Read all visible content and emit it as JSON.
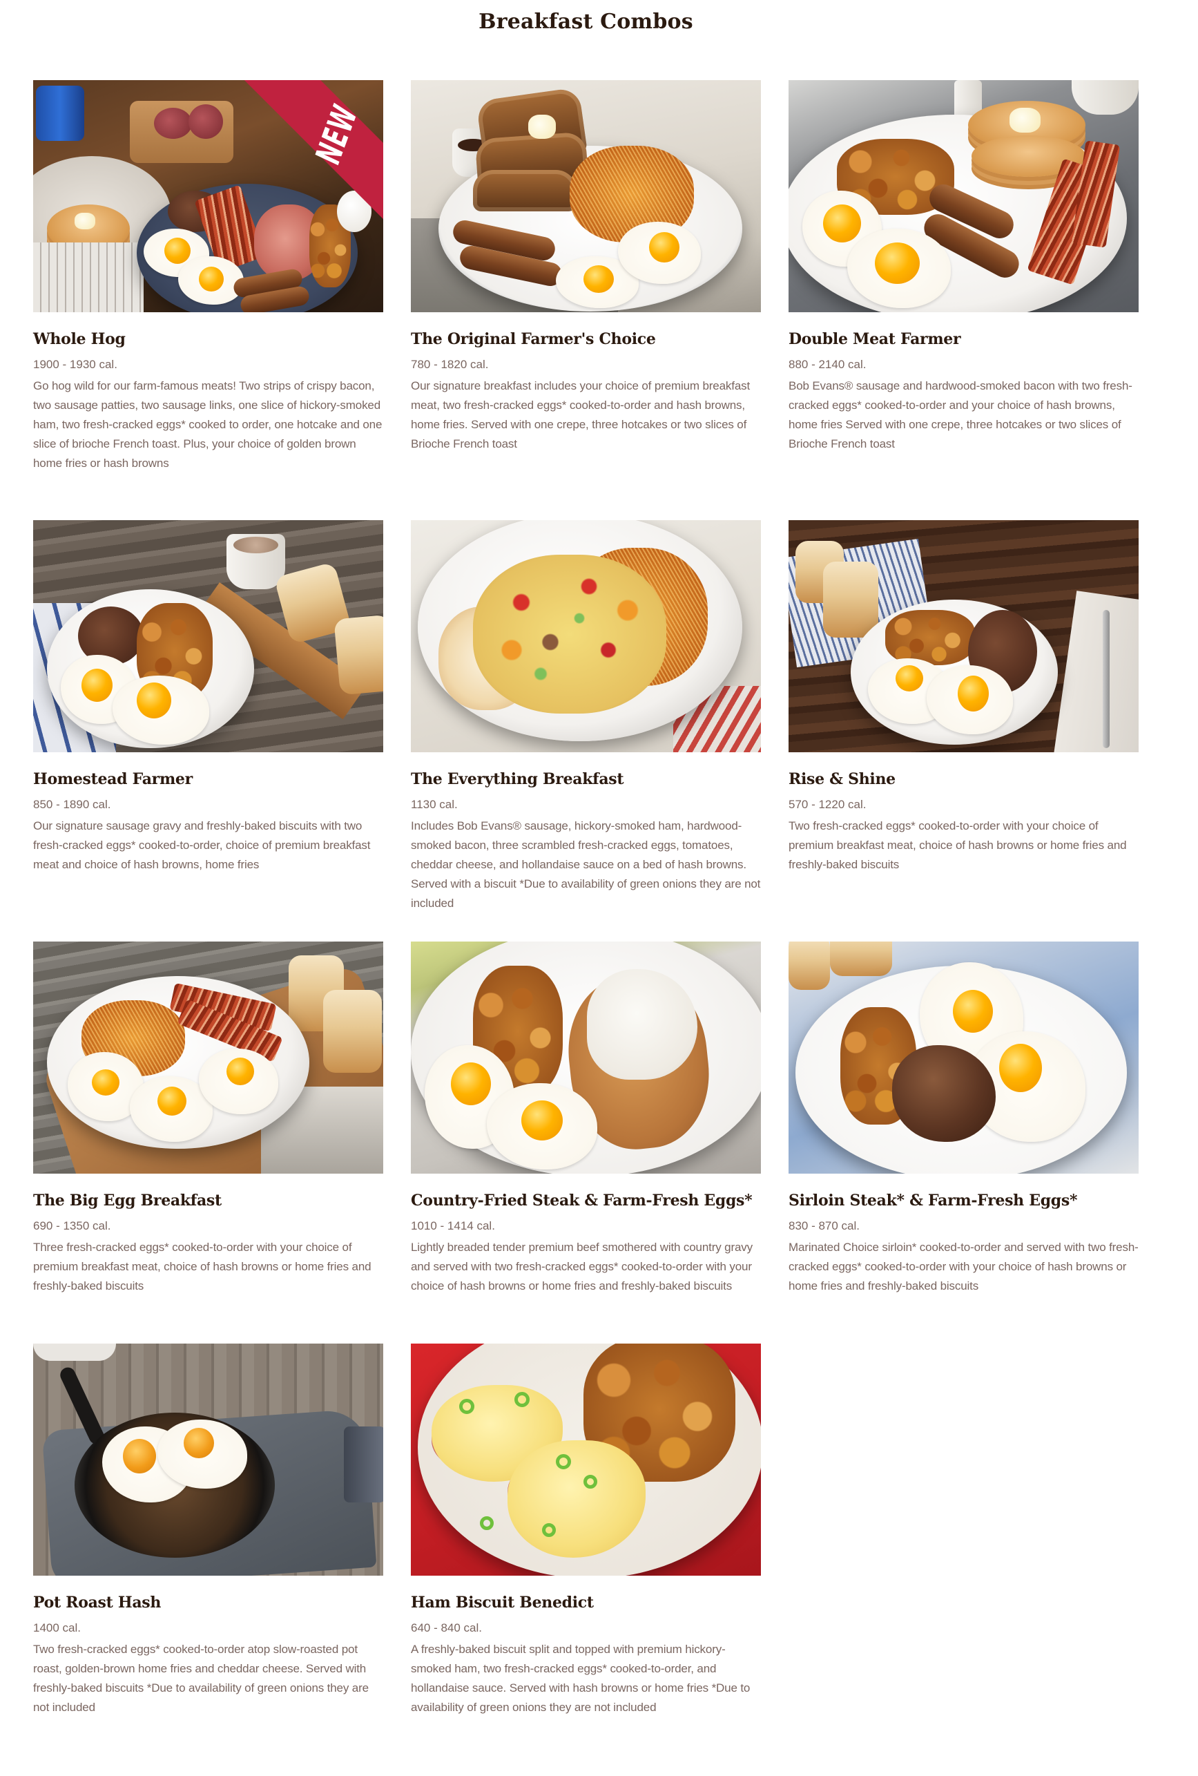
{
  "page": {
    "title": "Breakfast Combos"
  },
  "badges": {
    "new_label": "NEW"
  },
  "items": [
    {
      "name": "Whole Hog",
      "calories": "1900 - 1930 cal.",
      "description": "Go hog wild for our farm-famous meats! Two strips of crispy bacon, two sausage patties, two sausage links, one slice of hickory-smoked ham, two fresh-cracked eggs* cooked to order, one hotcake and one slice of brioche French toast. Plus, your choice of golden brown home fries or hash browns",
      "badge": "NEW",
      "image_icon": "whole-hog-photo"
    },
    {
      "name": "The Original Farmer's Choice",
      "calories": "780 - 1820 cal.",
      "description": "Our signature breakfast includes your choice of premium breakfast meat, two fresh-cracked eggs* cooked-to-order and hash browns, home fries. Served with one crepe, three hotcakes or two slices of Brioche French toast",
      "image_icon": "original-farmers-choice-photo"
    },
    {
      "name": "Double Meat Farmer",
      "calories": "880 - 2140 cal.",
      "description": "Bob Evans® sausage and hardwood-smoked bacon with two fresh-cracked eggs* cooked-to-order and your choice of  hash browns, home fries Served with one crepe, three hotcakes or two slices of Brioche French toast",
      "image_icon": "double-meat-farmer-photo"
    },
    {
      "name": "Homestead Farmer",
      "calories": "850 - 1890 cal.",
      "description": "Our signature sausage gravy and freshly-baked biscuits with two fresh-cracked eggs* cooked-to-order, choice of premium breakfast meat and choice of hash browns, home fries",
      "image_icon": "homestead-farmer-photo"
    },
    {
      "name": "The Everything Breakfast",
      "calories": "1130 cal.",
      "description": "Includes Bob Evans® sausage, hickory-smoked ham, hardwood-smoked bacon, three scrambled fresh-cracked eggs, tomatoes, cheddar cheese, and hollandaise sauce on a bed of hash browns. Served with a biscuit *Due to availability of green onions they are not included",
      "image_icon": "everything-breakfast-photo"
    },
    {
      "name": "Rise & Shine",
      "calories": "570 - 1220 cal.",
      "description": "Two fresh-cracked eggs* cooked-to-order with your choice of premium breakfast meat, choice of hash browns or home fries and freshly-baked biscuits",
      "image_icon": "rise-and-shine-photo"
    },
    {
      "name": "The Big Egg Breakfast",
      "calories": "690 - 1350 cal.",
      "description": "Three fresh-cracked eggs* cooked-to-order with your choice of premium breakfast meat, choice of hash browns or home fries and freshly-baked biscuits",
      "image_icon": "big-egg-breakfast-photo"
    },
    {
      "name": "Country-Fried Steak & Farm-Fresh Eggs*",
      "calories": "1010 - 1414 cal.",
      "description": "Lightly breaded tender premium beef smothered with country gravy and served with two fresh-cracked eggs* cooked-to-order with your choice of hash browns or home fries and freshly-baked biscuits",
      "image_icon": "country-fried-steak-photo"
    },
    {
      "name": "Sirloin Steak* & Farm-Fresh Eggs*",
      "calories": "830 - 870 cal.",
      "description": "Marinated Choice sirloin* cooked-to-order and served with two fresh-cracked eggs* cooked-to-order with your choice of hash browns or home fries and freshly-baked biscuits",
      "image_icon": "sirloin-steak-photo"
    },
    {
      "name": "Pot Roast Hash",
      "calories": "1400 cal.",
      "description": "Two fresh-cracked eggs* cooked-to-order atop slow-roasted pot roast, golden-brown home fries and cheddar cheese. Served with freshly-baked biscuits  *Due to availability of green onions they are not included",
      "image_icon": "pot-roast-hash-photo"
    },
    {
      "name": "Ham Biscuit Benedict",
      "calories": "640 - 840 cal.",
      "description": "A freshly-baked biscuit split and topped with premium hickory-smoked ham, two fresh-cracked eggs* cooked-to-order, and hollandaise sauce. Served with hash browns or home fries *Due to availability of green onions they are not included",
      "image_icon": "ham-biscuit-benedict-photo"
    }
  ],
  "colors": {
    "heading": "#2b1a10",
    "body_text": "#7a6660",
    "new_banner": "#c0223f"
  }
}
